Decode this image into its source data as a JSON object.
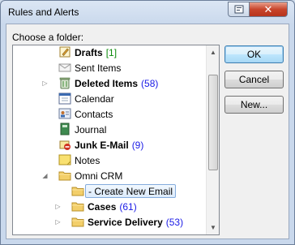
{
  "window": {
    "title": "Rules and Alerts"
  },
  "dialog": {
    "prompt": "Choose a folder:"
  },
  "buttons": {
    "ok": "OK",
    "cancel": "Cancel",
    "new": "New..."
  },
  "tree": [
    {
      "label": "Drafts",
      "count": "[1]",
      "bold": true,
      "count_style": "green",
      "icon": "drafts-icon",
      "level": 1,
      "arrow": ""
    },
    {
      "label": "Sent Items",
      "count": "",
      "bold": false,
      "icon": "sent-items-icon",
      "level": 1,
      "arrow": ""
    },
    {
      "label": "Deleted Items",
      "count": "(58)",
      "bold": true,
      "icon": "deleted-items-icon",
      "level": 1,
      "arrow": "collapsed"
    },
    {
      "label": "Calendar",
      "count": "",
      "bold": false,
      "icon": "calendar-icon",
      "level": 1,
      "arrow": ""
    },
    {
      "label": "Contacts",
      "count": "",
      "bold": false,
      "icon": "contacts-icon",
      "level": 1,
      "arrow": ""
    },
    {
      "label": "Journal",
      "count": "",
      "bold": false,
      "icon": "journal-icon",
      "level": 1,
      "arrow": ""
    },
    {
      "label": "Junk E-Mail",
      "count": "(9)",
      "bold": true,
      "icon": "junk-email-icon",
      "level": 1,
      "arrow": ""
    },
    {
      "label": "Notes",
      "count": "",
      "bold": false,
      "icon": "notes-icon",
      "level": 1,
      "arrow": ""
    },
    {
      "label": "Omni CRM",
      "count": "",
      "bold": false,
      "icon": "folder-icon",
      "level": 1,
      "arrow": "expanded"
    },
    {
      "label": "- Create New Email",
      "count": "",
      "bold": false,
      "icon": "folder-icon",
      "level": 2,
      "arrow": "",
      "selected": true
    },
    {
      "label": "Cases",
      "count": "(61)",
      "bold": true,
      "icon": "folder-icon",
      "level": 2,
      "arrow": "collapsed"
    },
    {
      "label": "Service Delivery",
      "count": "(53)",
      "bold": true,
      "icon": "folder-icon",
      "level": 2,
      "arrow": "collapsed"
    }
  ]
}
